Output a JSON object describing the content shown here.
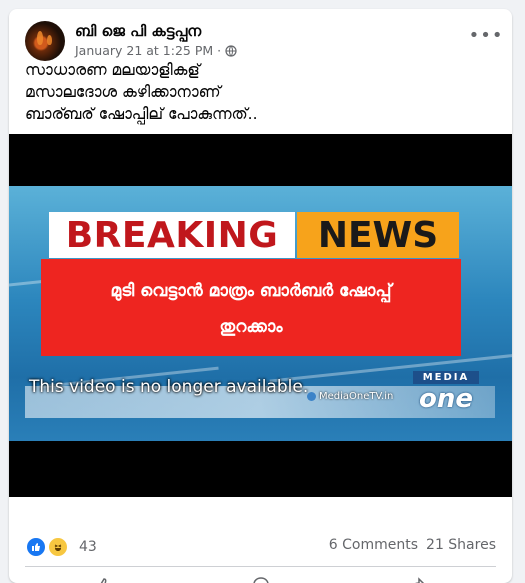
{
  "post": {
    "page_name": "ബി ജെ പി കട്ടപ്പന",
    "date": "January 21 at 1:25 PM",
    "separator": "·",
    "more_label": "•••",
    "text_lines": [
      "സാധാരണ മലയാളികള്",
      "മസാലദോശ കഴിക്കാനാണ്",
      "ബാര്ബര് ഷോപ്പില് പോകുന്നത്.."
    ]
  },
  "media": {
    "breaking_label": "BREAKING",
    "news_label": "NEWS",
    "headline_line1": "മുടി വെട്ടാൻ മാത്രം ബാർബർ ഷോപ്പ്",
    "headline_line2": "തുറക്കാം",
    "unavailable_text": "This video is no longer available.",
    "handle_text": "MediaOneTV.in",
    "logo_top": "MEDIA",
    "logo_bottom": "one"
  },
  "footer": {
    "reaction_count": "43",
    "comments": "6 Comments",
    "shares": "21 Shares"
  },
  "colors": {
    "breaking_red": "#c0171c",
    "news_orange": "#f7a31b",
    "headline_red": "#ee2520",
    "fb_blue": "#1877f2"
  }
}
